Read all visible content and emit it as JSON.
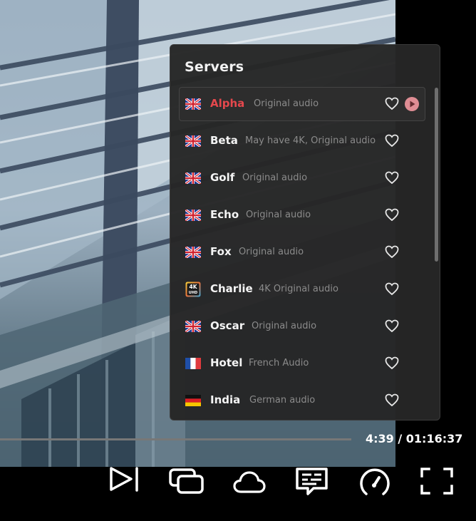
{
  "panel": {
    "title": "Servers"
  },
  "servers": [
    {
      "name": "Alpha",
      "desc": "Original audio",
      "flag": "uk-flag-icon",
      "active": true
    },
    {
      "name": "Beta",
      "desc": "May have 4K, Original audio",
      "flag": "uk-flag-icon",
      "active": false
    },
    {
      "name": "Golf",
      "desc": "Original audio",
      "flag": "uk-flag-icon",
      "active": false
    },
    {
      "name": "Echo",
      "desc": "Original audio",
      "flag": "uk-flag-icon",
      "active": false
    },
    {
      "name": "Fox",
      "desc": "Original audio",
      "flag": "uk-flag-icon",
      "active": false
    },
    {
      "name": "Charlie",
      "desc": "4K Original audio",
      "flag": "4k-uhd-icon",
      "active": false
    },
    {
      "name": "Oscar",
      "desc": "Original audio",
      "flag": "uk-flag-icon",
      "active": false
    },
    {
      "name": "Hotel",
      "desc": "French Audio",
      "flag": "france-flag-icon",
      "active": false
    },
    {
      "name": "India",
      "desc": "German audio",
      "flag": "germany-flag-icon",
      "active": false
    }
  ],
  "player": {
    "time": "4:39 / 01:16:37",
    "progress": 0.0,
    "controls": [
      "next-icon",
      "episodes-icon",
      "cloud-icon",
      "subtitles-icon",
      "speed-icon",
      "fullscreen-icon"
    ]
  },
  "colors": {
    "accent": "#e5484d",
    "panel_bg": "#262626"
  }
}
